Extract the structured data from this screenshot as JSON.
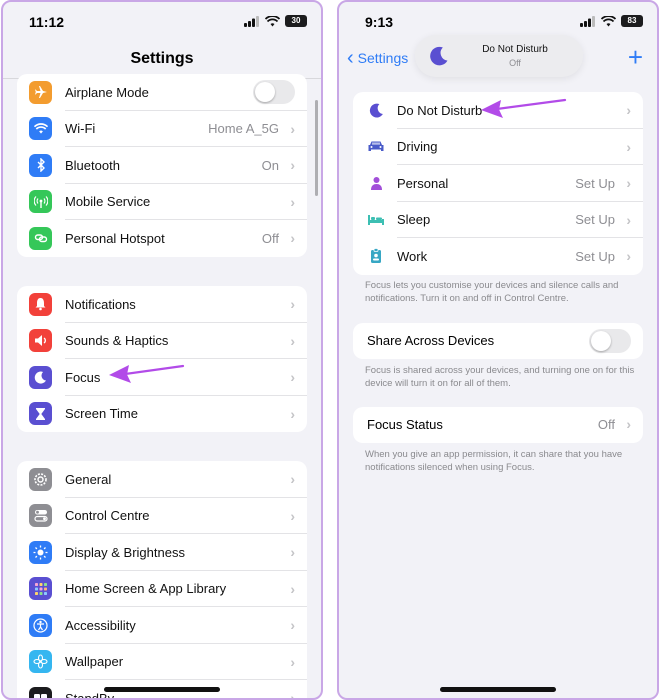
{
  "left": {
    "time": "11:12",
    "battery": "30",
    "title": "Settings",
    "group1": [
      {
        "label": "Airplane Mode",
        "value": "",
        "icon": "airplane-icon",
        "color": "#f39c2f",
        "toggle": true
      },
      {
        "label": "Wi-Fi",
        "value": "Home A_5G",
        "icon": "wifi-icon",
        "color": "#2f7cf6"
      },
      {
        "label": "Bluetooth",
        "value": "On",
        "icon": "bluetooth-icon",
        "color": "#2f7cf6"
      },
      {
        "label": "Mobile Service",
        "value": "",
        "icon": "antenna-icon",
        "color": "#35c759"
      },
      {
        "label": "Personal Hotspot",
        "value": "Off",
        "icon": "link-icon",
        "color": "#35c759"
      }
    ],
    "group2": [
      {
        "label": "Notifications",
        "value": "",
        "icon": "bell-icon",
        "color": "#f2413a"
      },
      {
        "label": "Sounds & Haptics",
        "value": "",
        "icon": "speaker-icon",
        "color": "#f2413a"
      },
      {
        "label": "Focus",
        "value": "",
        "icon": "moon-icon",
        "color": "#5a4fd1"
      },
      {
        "label": "Screen Time",
        "value": "",
        "icon": "hourglass-icon",
        "color": "#5a4fd1"
      }
    ],
    "group3": [
      {
        "label": "General",
        "value": "",
        "icon": "gear-icon",
        "color": "#8e8e93"
      },
      {
        "label": "Control Centre",
        "value": "",
        "icon": "switches-icon",
        "color": "#8e8e93"
      },
      {
        "label": "Display & Brightness",
        "value": "",
        "icon": "sun-icon",
        "color": "#2f7cf6"
      },
      {
        "label": "Home Screen & App Library",
        "value": "",
        "icon": "grid-icon",
        "color": "#5a4fd1"
      },
      {
        "label": "Accessibility",
        "value": "",
        "icon": "accessibility-icon",
        "color": "#2f7cf6"
      },
      {
        "label": "Wallpaper",
        "value": "",
        "icon": "flower-icon",
        "color": "#35b6f0"
      },
      {
        "label": "StandBy",
        "value": "",
        "icon": "standby-icon",
        "color": "#1c1c1e"
      }
    ]
  },
  "right": {
    "time": "9:13",
    "battery": "83",
    "back_label": "Settings",
    "add_label": "+",
    "pill_title": "Do Not Disturb",
    "pill_subtitle": "Off",
    "modes": [
      {
        "label": "Do Not Disturb",
        "value": "",
        "icon": "moon-icon",
        "color": "#5a4fd1"
      },
      {
        "label": "Driving",
        "value": "",
        "icon": "car-icon",
        "color": "#4a5bc9"
      },
      {
        "label": "Personal",
        "value": "Set Up",
        "icon": "person-icon",
        "color": "#a24fd9"
      },
      {
        "label": "Sleep",
        "value": "Set Up",
        "icon": "bed-icon",
        "color": "#3dbfb3"
      },
      {
        "label": "Work",
        "value": "Set Up",
        "icon": "badge-icon",
        "color": "#37a7c4"
      }
    ],
    "modes_footnote": "Focus lets you customise your devices and silence calls and notifications. Turn it on and off in Control Centre.",
    "share_label": "Share Across Devices",
    "share_footnote": "Focus is shared across your devices, and turning one on for this device will turn it on for all of them.",
    "status_label": "Focus Status",
    "status_value": "Off",
    "status_footnote": "When you give an app permission, it can share that you have notifications silenced when using Focus."
  },
  "colors": {
    "accent": "#2f7cf6",
    "arrow": "#b24be8",
    "background": "#f2f2f7"
  }
}
